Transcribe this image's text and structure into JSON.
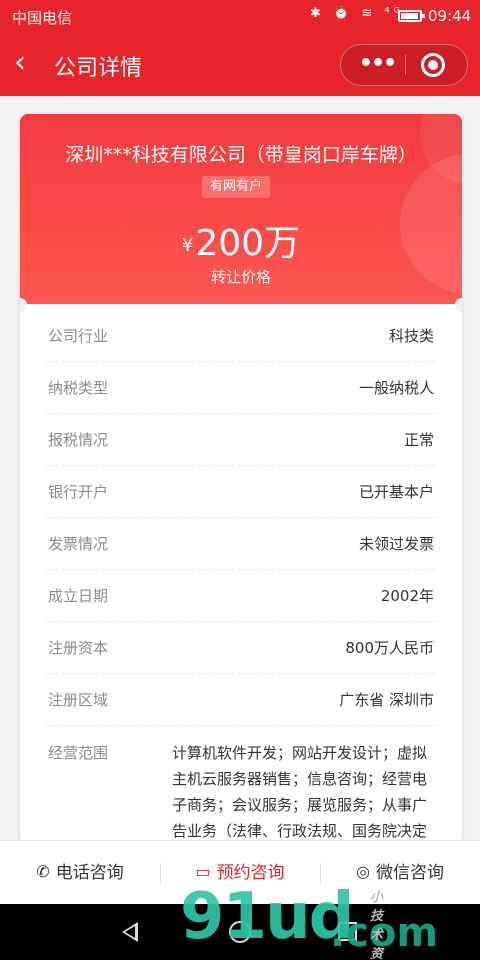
{
  "status_bar": {
    "carrier": "中国电信",
    "icons": "✱ ⏰ ≋ ⁴ᴳ",
    "time": "09:44"
  },
  "nav": {
    "back_icon": "‹",
    "title": "公司详情",
    "more_icon": "•••"
  },
  "hero": {
    "company_name": "深圳***科技有限公司（带皇岗口岸车牌）",
    "badge": "有网有户",
    "currency": "¥",
    "price": "200万",
    "price_label": "转让价格"
  },
  "details": [
    {
      "key": "公司行业",
      "value": "科技类"
    },
    {
      "key": "纳税类型",
      "value": "一般纳税人"
    },
    {
      "key": "报税情况",
      "value": "正常"
    },
    {
      "key": "银行开户",
      "value": "已开基本户"
    },
    {
      "key": "发票情况",
      "value": "未领过发票"
    },
    {
      "key": "成立日期",
      "value": "2002年"
    },
    {
      "key": "注册资本",
      "value": "800万人民币"
    },
    {
      "key": "注册区域",
      "value": "广东省 深圳市"
    }
  ],
  "scope": {
    "key": "经营范围",
    "value": "计算机软件开发；网站开发设计；虚拟主机云服务器销售；信息咨询；经营电子商务；会议服务；展览服务；从事广告业务（法律、行政法规、国务院决定"
  },
  "bottom_bar": {
    "phone": {
      "icon": "✆",
      "label": "电话咨询"
    },
    "booking": {
      "icon": "▭",
      "label": "预约咨询"
    },
    "wechat": {
      "icon": "◎",
      "label": "微信咨询"
    }
  },
  "watermark": {
    "main": "91ud",
    "suffix": ".com",
    "small": "小技术资源"
  },
  "colors": {
    "brand_red": "#e8242b",
    "accent_active": "#e8242b"
  }
}
